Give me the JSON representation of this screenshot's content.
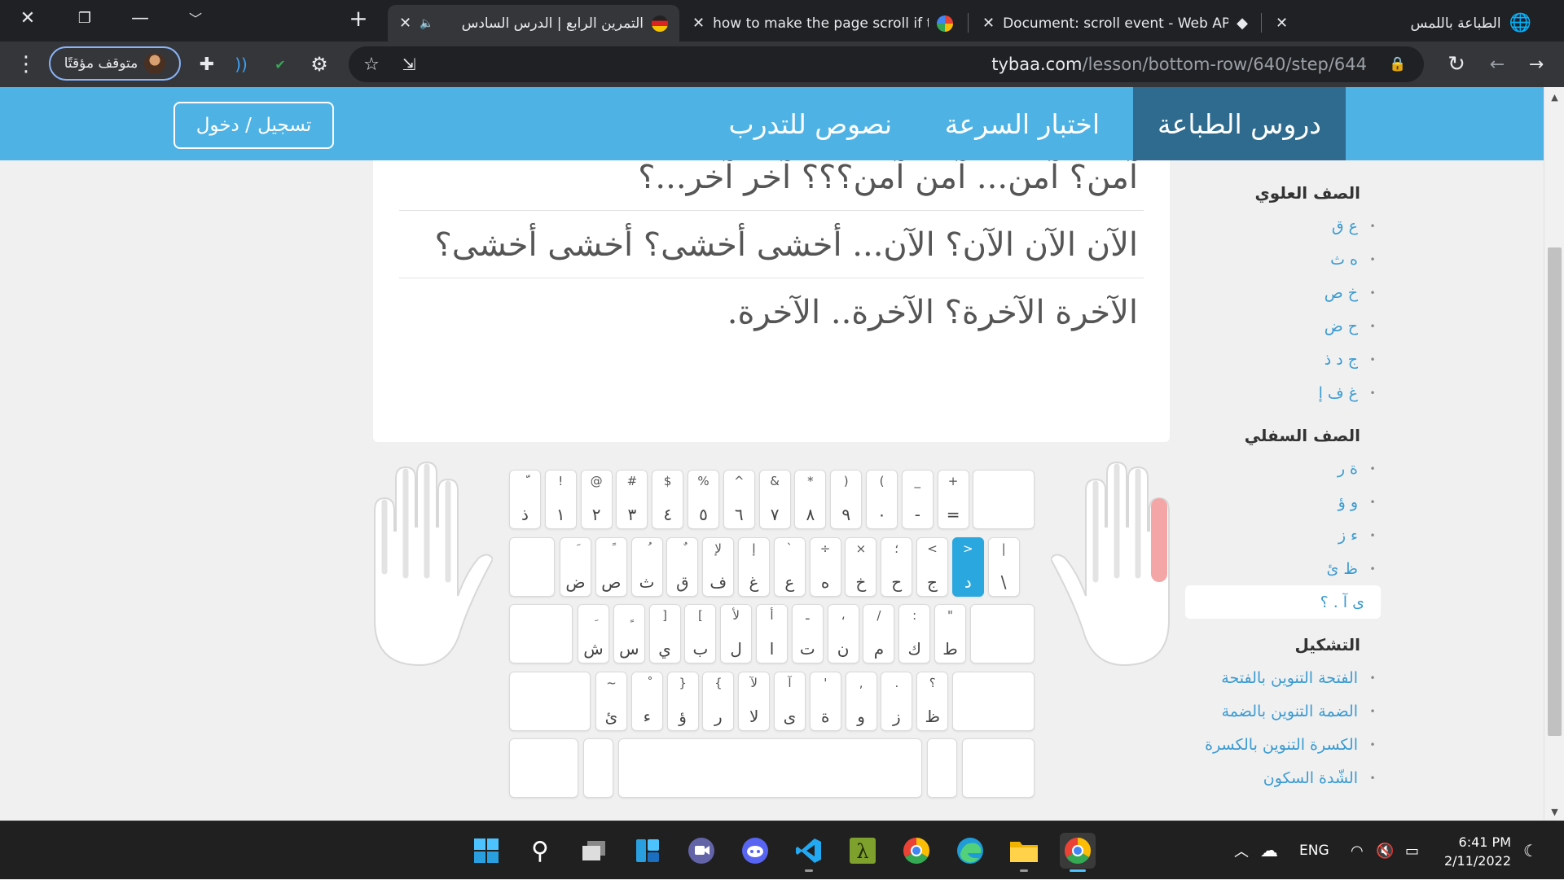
{
  "browser": {
    "tabs": [
      {
        "title": "التمرين الرابع | الدرس السادس",
        "active": true,
        "audio": true
      },
      {
        "title": "how to make the page scroll if th"
      },
      {
        "title": "Document: scroll event - Web AP"
      },
      {
        "title": "الطباعة باللمس"
      }
    ],
    "profile_status": "متوقف مؤقتًا",
    "url_host": "tybaa.com",
    "url_path": "/lesson/bottom-row/640/step/644"
  },
  "site": {
    "nav": {
      "lessons": "دروس الطباعة",
      "speed_test": "اختبار السرعة",
      "practice_texts": "نصوص للتدرب",
      "login": "تسجيل / دخول"
    },
    "sidebar": {
      "sections": [
        {
          "heading": "الصف العلوي",
          "items": [
            "ع ق",
            "ه ث",
            "خ ص",
            "ح ض",
            "ج د ذ",
            "غ ف إ"
          ]
        },
        {
          "heading": "الصف السفلي",
          "items": [
            "ة ر",
            "و ؤ",
            "ء ز",
            "ظ ئ",
            "ى آ . ؟"
          ]
        },
        {
          "heading": "التشكيل",
          "items": [
            "الفتحة التنوين بالفتحة",
            "الضمة التنوين بالضمة",
            "الكسرة التنوين بالكسرة",
            "الشّدة السكون"
          ]
        }
      ],
      "active_item": "ى آ . ؟"
    },
    "exercise_lines": [
      "آمن؟ آمن... آمن آمن؟؟؟ آخر آخر...؟",
      "الآن الآن الآن؟ الآن... أخشى أخشى؟ أخشى أخشى؟",
      "الآخرة الآخرة؟ الآخرة.. الآخرة."
    ],
    "keyboard": {
      "row0": [
        [
          "ّ",
          "ذ"
        ],
        [
          "!",
          "١"
        ],
        [
          "@",
          "٢"
        ],
        [
          "#",
          "٣"
        ],
        [
          "$",
          "٤"
        ],
        [
          "%",
          "٥"
        ],
        [
          "^",
          "٦"
        ],
        [
          "&",
          "٧"
        ],
        [
          "*",
          "٨"
        ],
        [
          ")",
          "٩"
        ],
        [
          "(",
          "٠"
        ],
        [
          "_",
          "-"
        ],
        [
          "+",
          "="
        ]
      ],
      "row1": [
        [
          "َ",
          "ض"
        ],
        [
          "ً",
          "ص"
        ],
        [
          "ُ",
          "ث"
        ],
        [
          "ٌ",
          "ق"
        ],
        [
          "لإ",
          "ف"
        ],
        [
          "إ",
          "غ"
        ],
        [
          "`",
          "ع"
        ],
        [
          "÷",
          "ه"
        ],
        [
          "×",
          "خ"
        ],
        [
          "؛",
          "ح"
        ],
        [
          "<",
          "ج"
        ],
        [
          ">",
          "د"
        ],
        [
          "|",
          "\\"
        ]
      ],
      "row2": [
        [
          "ِ",
          "ش"
        ],
        [
          "ٍ",
          "س"
        ],
        [
          "]",
          "ي"
        ],
        [
          "[",
          "ب"
        ],
        [
          "لأ",
          "ل"
        ],
        [
          "أ",
          "ا"
        ],
        [
          "ـ",
          "ت"
        ],
        [
          "،",
          "ن"
        ],
        [
          "/",
          "م"
        ],
        [
          ":",
          "ك"
        ],
        [
          "\"",
          "ط"
        ]
      ],
      "row3": [
        [
          "~",
          "ئ"
        ],
        [
          "ْ",
          "ء"
        ],
        [
          "}",
          "ؤ"
        ],
        [
          "{",
          "ر"
        ],
        [
          "لآ",
          "لا"
        ],
        [
          "آ",
          "ى"
        ],
        [
          "'",
          "ة"
        ],
        [
          ",",
          "و"
        ],
        [
          ".",
          "ز"
        ],
        [
          "؟",
          "ظ"
        ]
      ],
      "highlighted_key": "د"
    }
  },
  "taskbar": {
    "language": "ENG",
    "time": "6:41 PM",
    "date": "2/11/2022"
  },
  "colors": {
    "nav_bg": "#4eb3e4",
    "nav_active": "#2e6b8e",
    "link": "#3b9bd1",
    "key_highlight": "#2aa7de",
    "finger_highlight": "#f4a6a6"
  }
}
